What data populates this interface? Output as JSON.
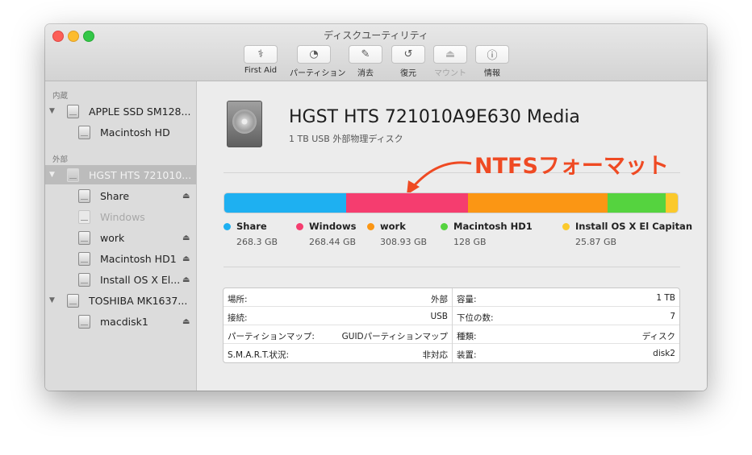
{
  "window": {
    "title": "ディスクユーティリティ"
  },
  "toolbar": [
    {
      "label": "First Aid",
      "icon": "first-aid-icon",
      "glyph": "⚕",
      "enabled": true
    },
    {
      "label": "パーティション",
      "icon": "partition-icon",
      "glyph": "◔",
      "enabled": true
    },
    {
      "label": "消去",
      "icon": "erase-icon",
      "glyph": "✎",
      "enabled": true
    },
    {
      "label": "復元",
      "icon": "restore-icon",
      "glyph": "↺",
      "enabled": true
    },
    {
      "label": "マウント",
      "icon": "mount-icon",
      "glyph": "⏏",
      "enabled": false
    },
    {
      "label": "情報",
      "icon": "info-icon",
      "glyph": "ⓘ",
      "enabled": true
    }
  ],
  "sidebar": {
    "internal_label": "内蔵",
    "external_label": "外部",
    "items": [
      {
        "label": "APPLE SSD SM128...",
        "eject": ""
      },
      {
        "label": "Macintosh HD",
        "eject": ""
      },
      {
        "label": "HGST HTS 721010...",
        "eject": ""
      },
      {
        "label": "Share",
        "eject": "⏏"
      },
      {
        "label": "Windows",
        "eject": ""
      },
      {
        "label": "work",
        "eject": "⏏"
      },
      {
        "label": "Macintosh HD1",
        "eject": "⏏"
      },
      {
        "label": "Install OS X El...",
        "eject": "⏏"
      },
      {
        "label": "TOSHIBA MK1637...",
        "eject": ""
      },
      {
        "label": "macdisk1",
        "eject": "⏏"
      }
    ]
  },
  "disk": {
    "name": "HGST HTS 721010A9E630 Media",
    "subtitle": "1 TB USB 外部物理ディスク"
  },
  "annotation": {
    "text": "NTFSフォーマット",
    "color": "#ef4a23"
  },
  "partitions": [
    {
      "name": "Share",
      "size": "268.3 GB",
      "gb": 268.3,
      "color": "#1eb0f1"
    },
    {
      "name": "Windows",
      "size": "268.44 GB",
      "gb": 268.44,
      "color": "#f53d6f"
    },
    {
      "name": "work",
      "size": "308.93 GB",
      "gb": 308.93,
      "color": "#fb9614"
    },
    {
      "name": "Macintosh HD1",
      "size": "128 GB",
      "gb": 128,
      "color": "#55d33f"
    },
    {
      "name": "Install OS X El Capitan",
      "size": "25.87 GB",
      "gb": 25.87,
      "color": "#fbc92b"
    }
  ],
  "info": {
    "left": [
      {
        "key": "場所:",
        "value": "外部"
      },
      {
        "key": "接続:",
        "value": "USB"
      },
      {
        "key": "パーティションマップ:",
        "value": "GUIDパーティションマップ"
      },
      {
        "key": "S.M.A.R.T.状況:",
        "value": "非対応"
      }
    ],
    "right": [
      {
        "key": "容量:",
        "value": "1 TB"
      },
      {
        "key": "下位の数:",
        "value": "7"
      },
      {
        "key": "種類:",
        "value": "ディスク"
      },
      {
        "key": "装置:",
        "value": "disk2"
      }
    ]
  }
}
